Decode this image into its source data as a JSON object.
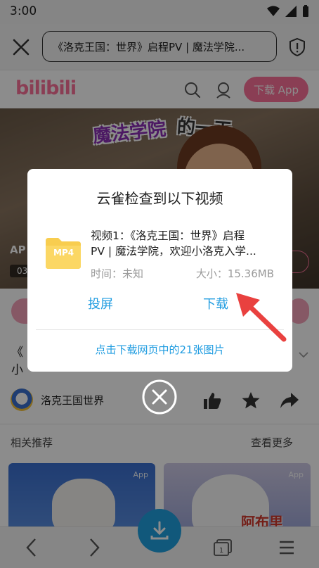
{
  "status": {
    "time": "3:00"
  },
  "browser": {
    "url": "《洛克王国：世界》启程PV | 魔法学院..."
  },
  "site": {
    "logo": "bilibili",
    "download_app": "下载 App"
  },
  "video": {
    "art_title_a": "魔法学院",
    "art_title_b": "的一天",
    "label": "AP",
    "time": "03"
  },
  "page": {
    "title_line1": "《",
    "title_line2": "小",
    "author": "洛克王国世界",
    "related": "相关推荐",
    "more": "查看更多",
    "card_badge": "App",
    "card2_text": "阿布里"
  },
  "dialog": {
    "title": "云雀检查到以下视频",
    "file_icon_label": "MP4",
    "file_name_line1": "视频1：《洛克王国：世界》启程",
    "file_name_line2": "PV | 魔法学院，欢迎小洛克入学...",
    "time_label": "时间：未知",
    "size_label": "大小：15.36MB",
    "cast": "投屏",
    "download": "下载",
    "images_link": "点击下载网页中的21张图片"
  },
  "colors": {
    "accent": "#1d9be0",
    "bili_pink": "#fb7299",
    "file_icon": "#f8cd4f",
    "arrow": "#e9413f"
  }
}
